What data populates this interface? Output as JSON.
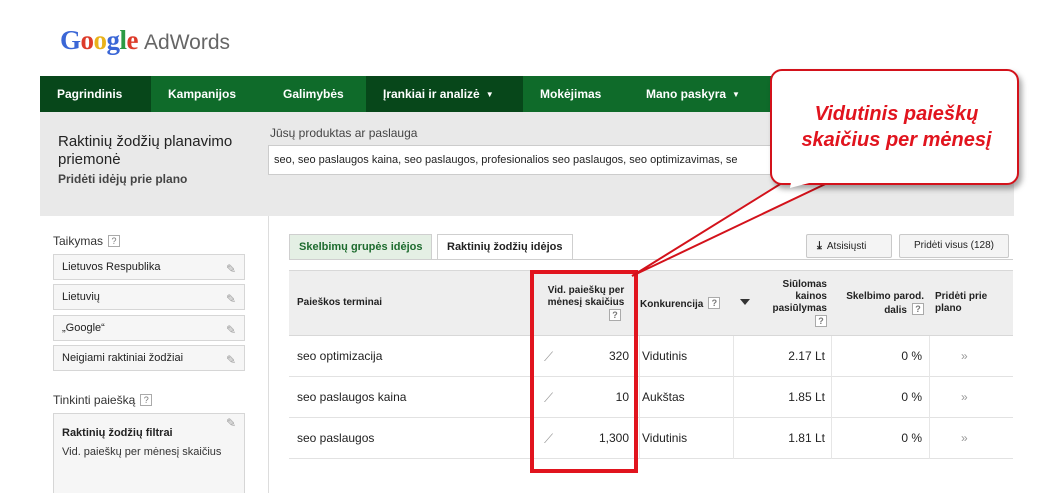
{
  "logo": {
    "letters": [
      "G",
      "o",
      "o",
      "g",
      "l",
      "e"
    ],
    "product": "AdWords"
  },
  "nav": {
    "items": [
      {
        "label": "Pagrindinis"
      },
      {
        "label": "Kampanijos"
      },
      {
        "label": "Galimybės"
      },
      {
        "label": "Įrankiai ir analizė"
      },
      {
        "label": "Mokėjimas"
      },
      {
        "label": "Mano paskyra"
      }
    ],
    "caret": "▼"
  },
  "header": {
    "title": "Raktinių žodžių planavimo priemonė",
    "add_ideas": "Pridėti idėjų prie plano",
    "product_label": "Jūsų produktas ar paslauga",
    "product_value": "seo, seo paslaugos kaina, seo paslaugos, profesionalios seo paslaugos, seo optimizavimas, se"
  },
  "sidebar": {
    "targeting_title": "Taikymas",
    "targeting_items": [
      {
        "label": "Lietuvos Respublika"
      },
      {
        "label": "Lietuvių"
      },
      {
        "label": "„Google“"
      },
      {
        "label": "Neigiami raktiniai žodžiai"
      }
    ],
    "customize_title": "Tinkinti paiešką",
    "filters_title": "Raktinių žodžių filtrai",
    "filters_sub": "Vid. paieškų per mėnesį skaičius"
  },
  "tabs": {
    "ad_groups": "Skelbimų grupės idėjos",
    "keywords": "Raktinių žodžių idėjos"
  },
  "buttons": {
    "download": "Atsisiųsti",
    "add_all": "Pridėti visus (128)"
  },
  "table": {
    "headers": {
      "term": "Paieškos terminai",
      "avg_searches": "Vid. paieškų per mėnesį skaičius",
      "competition": "Konkurencija",
      "suggested_bid": "Siūlomas kainos pasiūlymas",
      "impr_share": "Skelbimo parod. dalis",
      "add_to_plan": "Pridėti prie plano"
    },
    "rows": [
      {
        "term": "seo optimizacija",
        "searches": "320",
        "competition": "Vidutinis",
        "bid": "2.17 Lt",
        "share": "0 %",
        "add": "»"
      },
      {
        "term": "seo paslaugos kaina",
        "searches": "10",
        "competition": "Aukštas",
        "bid": "1.85 Lt",
        "share": "0 %",
        "add": "»"
      },
      {
        "term": "seo paslaugos",
        "searches": "1,300",
        "competition": "Vidutinis",
        "bid": "1.81 Lt",
        "share": "0 %",
        "add": "»"
      }
    ],
    "help_glyph": "?"
  },
  "callout": {
    "text": "Vidutinis paieškų skaičius per mėnesį"
  },
  "colors": {
    "nav_bg": "#0f6b2a",
    "nav_active": "#07471a",
    "highlight": "#e1141e"
  }
}
